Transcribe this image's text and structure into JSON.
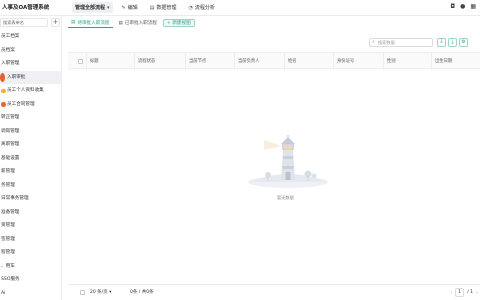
{
  "app": {
    "title": "人事及OA管理系统"
  },
  "top_menu": [
    {
      "label": "管理全部流程",
      "icon": "chevron-down-icon",
      "active": true
    },
    {
      "label": "编辑",
      "icon": "edit-icon"
    },
    {
      "label": "数据管理",
      "icon": "database-icon"
    },
    {
      "label": "流程分析",
      "icon": "analytics-icon"
    }
  ],
  "top_right": [
    "bell-icon",
    "avatar-icon",
    "grid-icon"
  ],
  "sidebar": {
    "search_placeholder": "搜索表单名",
    "add_label": "+",
    "items": [
      {
        "label": "员工档案",
        "type": "item"
      },
      {
        "label": "员档案",
        "type": "item"
      },
      {
        "label": "入职管理",
        "type": "item"
      },
      {
        "label": "入职审批",
        "type": "item",
        "active": true
      },
      {
        "label": "员工个人资料收集",
        "type": "sub",
        "dot_color": "#f3b12e"
      },
      {
        "label": "员工合同管理",
        "type": "sub",
        "dot_color": "#e86a2a"
      },
      {
        "label": "转正管理",
        "type": "item"
      },
      {
        "label": "调岗管理",
        "type": "item"
      },
      {
        "label": "离职管理",
        "type": "item"
      },
      {
        "label": "基础设置",
        "type": "item"
      },
      {
        "label": "薪管理",
        "type": "item"
      },
      {
        "label": "务管理",
        "type": "item"
      },
      {
        "label": "日常事务管理",
        "type": "item"
      },
      {
        "label": "准备管理",
        "type": "item"
      },
      {
        "label": "资管理",
        "type": "item"
      },
      {
        "label": "签管理",
        "type": "item"
      },
      {
        "label": "程管理",
        "type": "item"
      },
      {
        "label": "、用车",
        "type": "item"
      },
      {
        "label": "SSO服务",
        "type": "item"
      },
      {
        "label": "Ai",
        "type": "item"
      }
    ]
  },
  "tabs": [
    {
      "label": "待审批入职流程",
      "icon": "list-icon",
      "active": true
    },
    {
      "label": "已审批入职流程",
      "icon": "list-icon"
    },
    {
      "label": "+ 新建视图",
      "icon": "",
      "create": true
    }
  ],
  "toolbar": {
    "search_placeholder": "搜索数据",
    "buttons": [
      {
        "name": "filter-icon",
        "glyph": "⏚"
      },
      {
        "name": "export-icon",
        "glyph": "⤓"
      },
      {
        "name": "settings-icon",
        "glyph": "⚙"
      }
    ]
  },
  "table": {
    "columns": [
      "标题",
      "流程状态",
      "当前节点",
      "当前负责人",
      "姓名",
      "身份证号",
      "性别",
      "出生日期"
    ]
  },
  "empty": {
    "text": "暂无数据"
  },
  "pagination": {
    "page_size": "20 条/页",
    "info": "0条 / 共0条",
    "prev": "‹",
    "page": "1",
    "next": "›",
    "total": "/ 1"
  }
}
